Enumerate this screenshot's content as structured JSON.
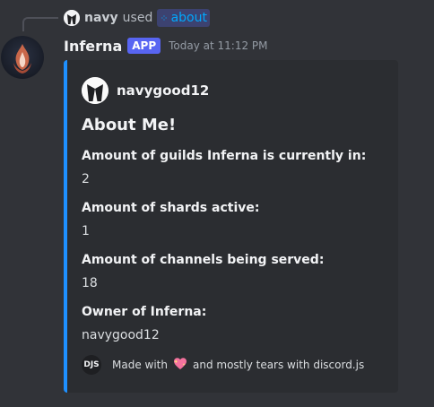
{
  "reply": {
    "user": "navy",
    "used_text": "used",
    "command": "about",
    "avatar_icon": "tuxedo-icon",
    "command_icon": "slash-command-icon"
  },
  "message": {
    "bot_name": "Inferna",
    "badge": "APP",
    "timestamp": "Today at 11:12 PM",
    "avatar_icon": "flame-emblem-icon"
  },
  "embed": {
    "accent_color": "#1e90ff",
    "author": "navygood12",
    "author_icon": "tuxedo-icon",
    "title": "About Me!",
    "fields": [
      {
        "name": "Amount of guilds Inferna is currently in:",
        "value": "2"
      },
      {
        "name": "Amount of shards active:",
        "value": "1"
      },
      {
        "name": "Amount of channels being served:",
        "value": "18"
      },
      {
        "name": "Owner of Inferna:",
        "value": "navygood12"
      }
    ],
    "footer": {
      "icon_text": "DJS",
      "text_before": "Made with",
      "heart_icon": "sparkling-heart-icon",
      "text_after": "and mostly tears with discord.js"
    }
  },
  "colors": {
    "background": "#313338",
    "embed_bg": "#2b2d31",
    "badge": "#5865f2",
    "link": "#00a8fc"
  }
}
